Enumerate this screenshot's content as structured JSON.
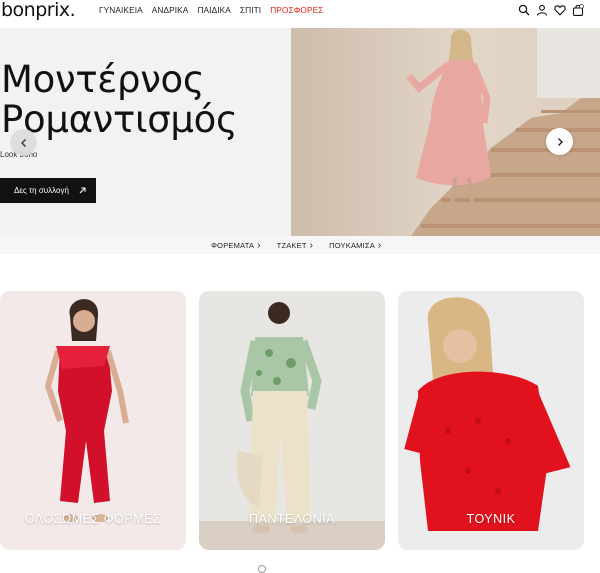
{
  "header": {
    "logo": "bonprix.",
    "nav": [
      "ΓΥΝΑΙΚΕΙΑ",
      "ΑΝΔΡΙΚΑ",
      "ΠΑΙΔΙΚΑ",
      "ΣΠΙΤΙ",
      "ΠΡΟΣΦΟΡΕΣ"
    ],
    "icons": [
      "search-icon",
      "account-icon",
      "wishlist-icon",
      "cart-icon"
    ],
    "cart_count": "0"
  },
  "hero": {
    "title_line1": "Μοντέρνος",
    "title_line2": "Ρομαντισμός",
    "subtitle": "Look boho",
    "cta_label": "Δες τη συλλογή"
  },
  "category_links": [
    "ΦΟΡΕΜΑΤΑ",
    "ΤΖΑΚΕΤ",
    "ΠΟΥΚΑΜΙΣΑ"
  ],
  "cards": [
    {
      "label": "ΟΛΟΣΩΜΕΣ ΦΟΡΜΕΣ"
    },
    {
      "label": "ΠΑΝΤΕΛΟΝΙΑ"
    },
    {
      "label": "ΤΟΥΝΙΚ"
    }
  ],
  "colors": {
    "sale": "#e2231a",
    "cta_bg": "#111111"
  }
}
